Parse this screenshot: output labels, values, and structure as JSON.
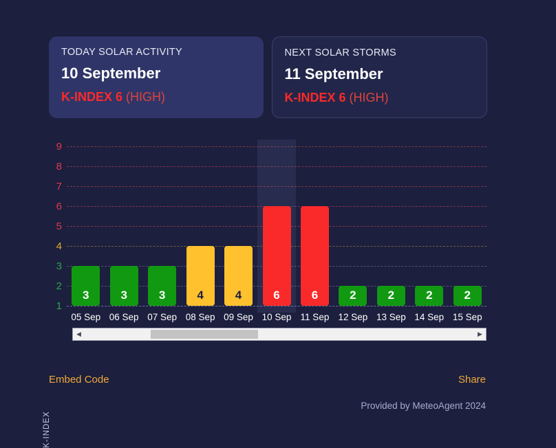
{
  "cards": [
    {
      "kicker": "TODAY SOLAR ACTIVITY",
      "date": "10 September",
      "kindex_value": "K-INDEX 6",
      "kindex_level": "(HIGH)"
    },
    {
      "kicker": "NEXT SOLAR STORMS",
      "date": "11 September",
      "kindex_value": "K-INDEX 6",
      "kindex_level": "(HIGH)"
    }
  ],
  "footer": {
    "embed_label": "Embed Code",
    "share_label": "Share",
    "credit": "Provided by MeteoAgent 2024"
  },
  "scrollbar": {
    "left_arrow": "◀",
    "right_arrow": "▶"
  },
  "colors": {
    "page_background": "#1c1f3d",
    "card_today_background": "#2f3568",
    "card_next_background": "#22264a",
    "low": "#119911",
    "moderate": "#ffc12e",
    "high": "#fa2a2a",
    "accent_link": "#f0a93c",
    "credit_text": "#a7adcf"
  },
  "chart_data": {
    "type": "bar",
    "title": "",
    "xlabel": "",
    "ylabel": "K-INDEX",
    "ylim": [
      0,
      9
    ],
    "grid": true,
    "legend": "none",
    "highlight_category": "10 Sep",
    "y_ticks": [
      {
        "value": 9,
        "color": "#e03a4e"
      },
      {
        "value": 8,
        "color": "#e03a4e"
      },
      {
        "value": 7,
        "color": "#e03a4e"
      },
      {
        "value": 6,
        "color": "#e03a4e"
      },
      {
        "value": 5,
        "color": "#e03a4e"
      },
      {
        "value": 4,
        "color": "#ddab2b"
      },
      {
        "value": 3,
        "color": "#2aa74a"
      },
      {
        "value": 2,
        "color": "#2aa74a"
      },
      {
        "value": 1,
        "color": "#2aa74a"
      }
    ],
    "categories": [
      "05 Sep",
      "06 Sep",
      "07 Sep",
      "08 Sep",
      "09 Sep",
      "10 Sep",
      "11 Sep",
      "12 Sep",
      "13 Sep",
      "14 Sep",
      "15 Sep"
    ],
    "values": [
      3,
      3,
      3,
      4,
      4,
      6,
      6,
      2,
      2,
      2,
      2
    ],
    "bar_colors": [
      "#119911",
      "#119911",
      "#119911",
      "#ffc12e",
      "#ffc12e",
      "#fa2a2a",
      "#fa2a2a",
      "#119911",
      "#119911",
      "#119911",
      "#119911"
    ],
    "label_colors": [
      "#ffffff",
      "#ffffff",
      "#ffffff",
      "#1c1f3d",
      "#1c1f3d",
      "#ffffff",
      "#ffffff",
      "#ffffff",
      "#ffffff",
      "#ffffff",
      "#ffffff"
    ]
  }
}
